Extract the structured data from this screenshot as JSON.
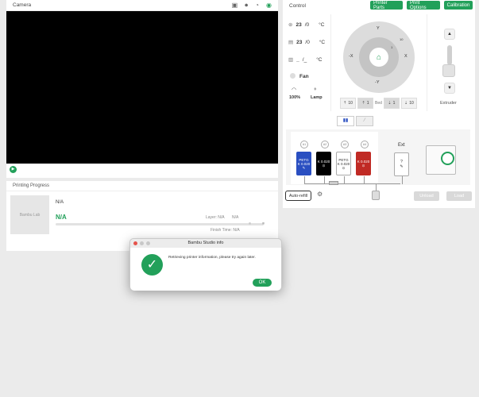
{
  "camera": {
    "title": "Camera",
    "icons": [
      "sd-card-icon",
      "record-icon",
      "timelapse-icon",
      "camera-on-icon"
    ]
  },
  "progress": {
    "title": "Printing Progress",
    "thumbnail_text": "Bambu Lab",
    "task_name": "N/A",
    "percent": "N/A",
    "layer_label": "Layer: N/A",
    "layer_extra": "N/A",
    "finish_time": "Finish Time: N/A"
  },
  "control": {
    "title": "Control",
    "buttons": {
      "printer_parts": "Printer Parts",
      "print_options": "Print Options",
      "calibration": "Calibration"
    },
    "nozzle": {
      "value": "23",
      "target": "/0",
      "unit": "°C"
    },
    "bed": {
      "value": "23",
      "target": "/0",
      "unit": "°C"
    },
    "chamber": {
      "value": "_",
      "target": "/_",
      "unit": "°C"
    },
    "fan_label": "Fan",
    "speed_value": "100%",
    "lamp_label": "Lamp",
    "jog": {
      "y": "Y",
      "neg_y": "-Y",
      "x": "X",
      "neg_x": "-X",
      "step10": "10",
      "step1": "1"
    },
    "bed_controls": {
      "up10": "10",
      "up1": "1",
      "label": "Bed",
      "down1": "1",
      "down10": "10"
    },
    "extruder_label": "Extruder"
  },
  "ams": {
    "humidity": "14",
    "humidity_unit": "%",
    "slots": [
      {
        "id": "A1",
        "type": "PETG",
        "brand": "K 0.020",
        "color": "#2a4fc1",
        "text_color": "#ffffff"
      },
      {
        "id": "A2",
        "type": "",
        "brand": "K 0.020",
        "color": "#000000",
        "text_color": "#ffffff"
      },
      {
        "id": "A3",
        "type": "PETG",
        "brand": "K 0.020",
        "color": "#ffffff",
        "text_color": "#333333"
      },
      {
        "id": "A4",
        "type": "",
        "brand": "K 0.020",
        "color": "#c02a24",
        "text_color": "#ffffff"
      }
    ],
    "ext_label": "Ext",
    "ext_slot": "?",
    "auto_refill": "Auto-refill",
    "unload": "Unload",
    "load": "Load"
  },
  "dialog": {
    "title": "Bambu Studio info",
    "message": "Retrieving printer information, please try again later.",
    "ok": "OK"
  }
}
